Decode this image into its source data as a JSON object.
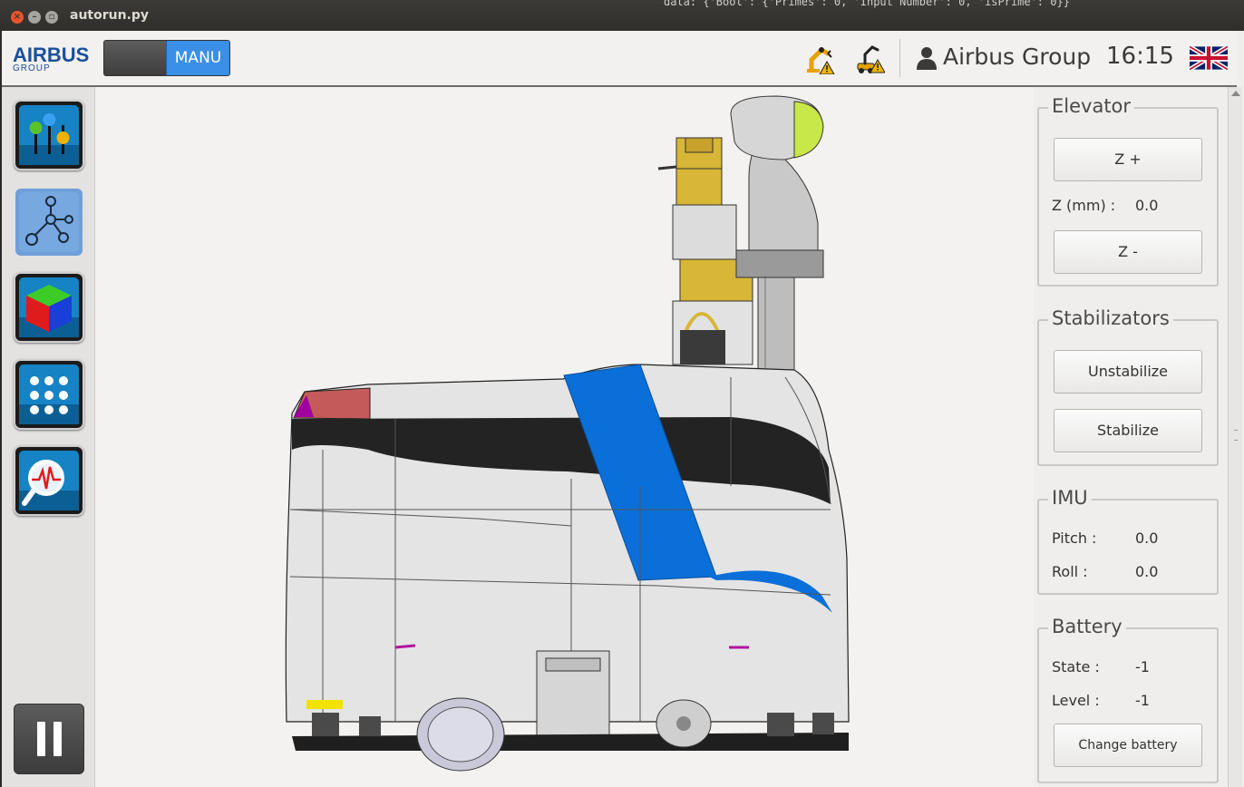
{
  "window": {
    "title": "autorun.py",
    "background_text": "data: {'Bool': {'Primes': 0, 'Input Number': 0, 'isPrime': 0}}"
  },
  "header": {
    "logo_main": "AIRBUS",
    "logo_sub": "GROUP",
    "mode_label": "MANU",
    "user_name": "Airbus Group",
    "clock": "16:15",
    "icons": [
      "robot-arm-warning-icon",
      "mobile-robot-warning-icon",
      "user-icon",
      "uk-flag-icon"
    ]
  },
  "sidebar": {
    "items": [
      {
        "name": "controls-icon"
      },
      {
        "name": "network-icon"
      },
      {
        "name": "cube-3d-icon"
      },
      {
        "name": "keypad-icon"
      },
      {
        "name": "diagnostics-icon"
      }
    ],
    "pause": "pause-icon"
  },
  "panel": {
    "elevator": {
      "title": "Elevator",
      "z_plus": "Z +",
      "z_label": "Z (mm) :",
      "z_value": "0.0",
      "z_minus": "Z -"
    },
    "stabilizators": {
      "title": "Stabilizators",
      "unstabilize": "Unstabilize",
      "stabilize": "Stabilize"
    },
    "imu": {
      "title": "IMU",
      "pitch_label": "Pitch :",
      "pitch_value": "0.0",
      "roll_label": "Roll :",
      "roll_value": "0.0"
    },
    "battery": {
      "title": "Battery",
      "state_label": "State  :",
      "state_value": "-1",
      "level_label": "Level :",
      "level_value": "-1",
      "change": "Change battery"
    }
  },
  "colors": {
    "accent_blue": "#3a8fe6",
    "logo_blue": "#1b4f9a",
    "robot_stripe": "#0a6fd8",
    "robot_head": "#c8e84a",
    "elevator_yellow": "#d6b23a"
  }
}
